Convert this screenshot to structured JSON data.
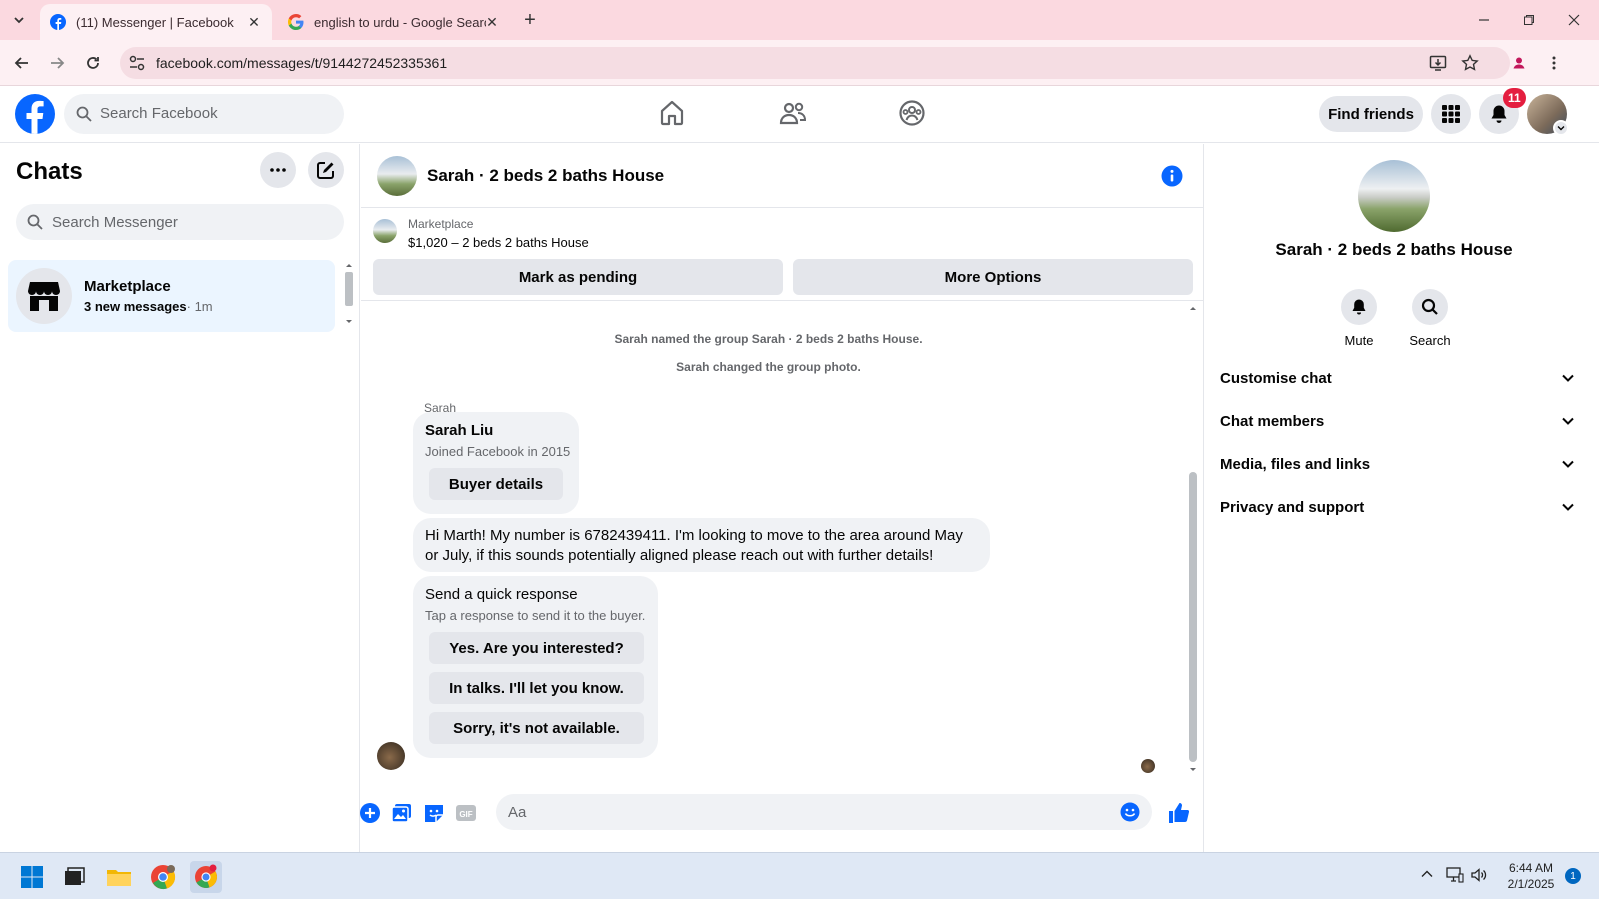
{
  "browser": {
    "tabs": [
      {
        "title": "(11) Messenger | Facebook",
        "active": true
      },
      {
        "title": "english to urdu - Google Search",
        "active": false
      }
    ],
    "url": "facebook.com/messages/t/9144272452335361"
  },
  "fb_header": {
    "search_placeholder": "Search Facebook",
    "find_friends_label": "Find friends",
    "notification_count": "11"
  },
  "chats": {
    "title": "Chats",
    "search_placeholder": "Search Messenger",
    "items": [
      {
        "name": "Marketplace",
        "preview": "3 new messages",
        "time": "· 1m"
      }
    ]
  },
  "conversation": {
    "title": "Sarah · 2 beds 2 baths House",
    "marketplace": {
      "label": "Marketplace",
      "listing": "$1,020 – 2 beds 2 baths House",
      "mark_pending_label": "Mark as pending",
      "more_options_label": "More Options"
    },
    "system_messages": [
      "Sarah named the group Sarah · 2 beds 2 baths House.",
      "Sarah changed the group photo."
    ],
    "sender_name": "Sarah",
    "profile_card": {
      "name": "Sarah Liu",
      "joined": "Joined Facebook in 2015",
      "button": "Buyer details"
    },
    "message_text": "Hi Marth! My number is 6782439411. I'm looking to move to the area around May or July, if this sounds potentially aligned please reach out with further details!",
    "quick_response": {
      "title": "Send a quick response",
      "subtitle": "Tap a response to send it to the buyer.",
      "options": [
        "Yes. Are you interested?",
        "In talks. I'll let you know.",
        "Sorry, it's not available."
      ]
    },
    "composer_placeholder": "Aa"
  },
  "right_panel": {
    "name": "Sarah · 2 beds 2 baths House",
    "actions": [
      {
        "label": "Mute",
        "icon": "bell-icon"
      },
      {
        "label": "Search",
        "icon": "search-icon"
      }
    ],
    "sections": [
      "Customise chat",
      "Chat members",
      "Media, files and links",
      "Privacy and support"
    ]
  },
  "taskbar": {
    "time": "6:44 AM",
    "date": "2/1/2025",
    "notification_count": "1"
  },
  "colors": {
    "fb_blue": "#0866ff",
    "selected_chat_bg": "#ebf5ff",
    "tab_strip": "#fbd9e0",
    "badge_red": "#e41e3f"
  }
}
